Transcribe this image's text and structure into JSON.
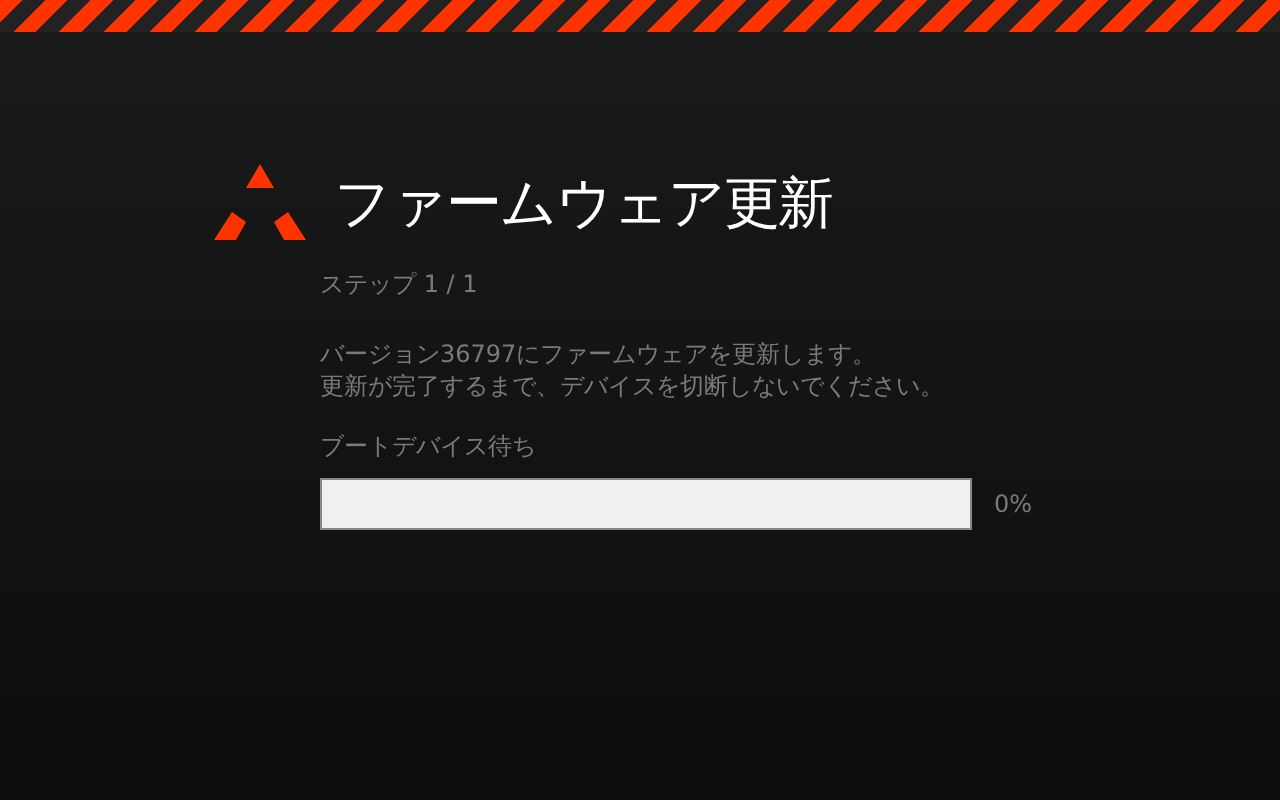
{
  "title": "ファームウェア更新",
  "step": "ステップ 1 / 1",
  "message": [
    "バージョン36797にファームウェアを更新します。",
    "更新が完了するまで、デバイスを切断しないでください。"
  ],
  "progress": {
    "label": "ブートデバイス待ち",
    "level": 0,
    "reading": "0%"
  }
}
